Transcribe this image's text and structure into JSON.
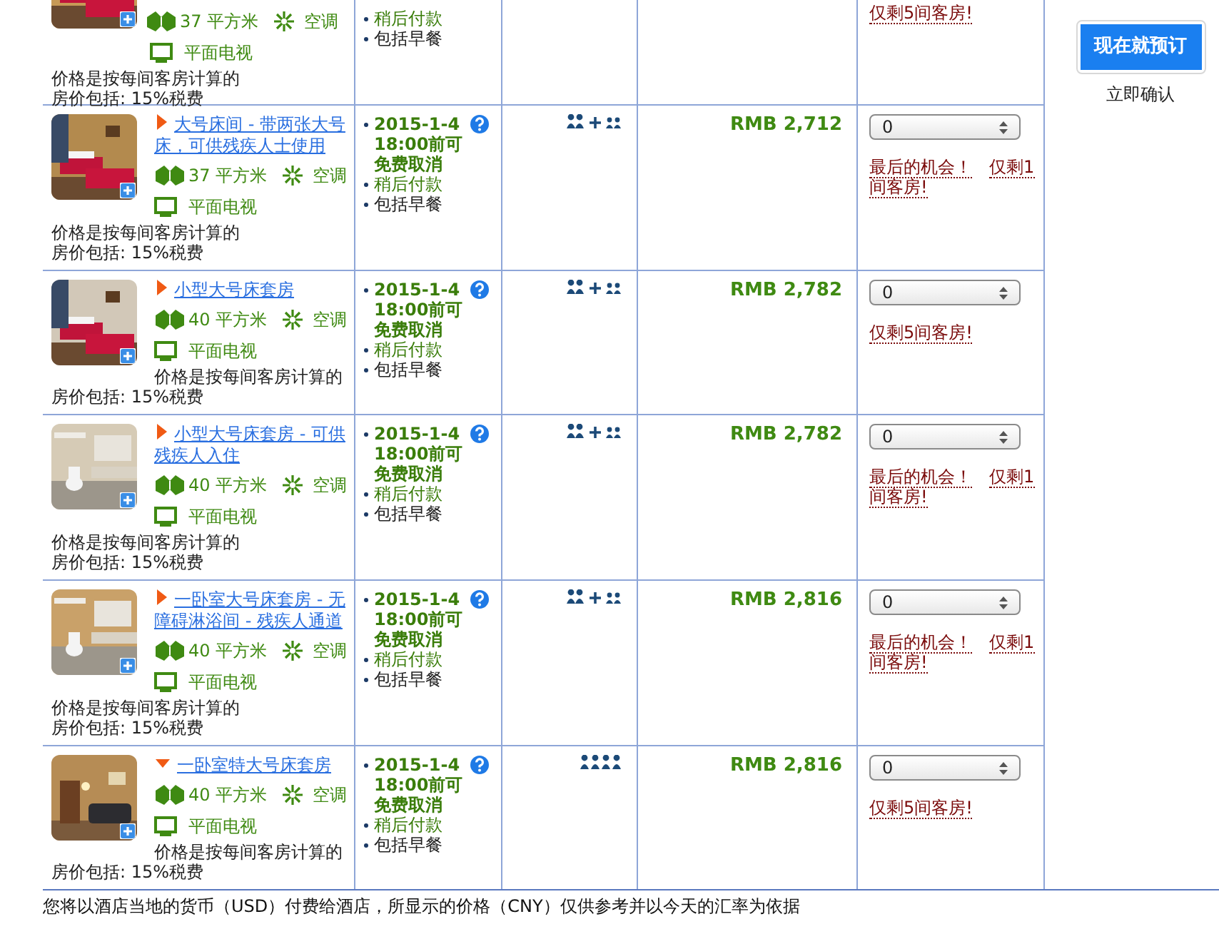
{
  "rooms": [
    {
      "size": "37 平方米",
      "aircon": "空调",
      "tv": "平面电视",
      "price_note": "价格是按每间客房计算的",
      "tax_note": "房价包括: 15%税费",
      "policies": [
        {
          "kind": "payment",
          "text": "稍后付款"
        },
        {
          "kind": "breakfast",
          "text": "包括早餐"
        }
      ],
      "availability": [
        "仅剩5间客房!"
      ]
    },
    {
      "title": "大号床间 - 带两张大号床，可供残疾人士使用",
      "expanded": false,
      "size": "37 平方米",
      "aircon": "空调",
      "tv": "平面电视",
      "price_note": "价格是按每间客房计算的",
      "tax_note": "房价包括: 15%税费",
      "policies": [
        {
          "kind": "cancel",
          "text": "2015-1-4 18:00前可免费取消"
        },
        {
          "kind": "payment",
          "text": "稍后付款"
        },
        {
          "kind": "breakfast",
          "text": "包括早餐"
        }
      ],
      "occupancy": {
        "kind": "adults_plus_children"
      },
      "price": "RMB 2,712",
      "quantity": "0",
      "availability": [
        "最后的机会！",
        "仅剩1间客房!"
      ]
    },
    {
      "title": "小型大号床套房",
      "expanded": false,
      "size": "40 平方米",
      "aircon": "空调",
      "tv": "平面电视",
      "price_note": "价格是按每间客房计算的",
      "tax_note": "房价包括: 15%税费",
      "policies": [
        {
          "kind": "cancel",
          "text": "2015-1-4 18:00前可免费取消"
        },
        {
          "kind": "payment",
          "text": "稍后付款"
        },
        {
          "kind": "breakfast",
          "text": "包括早餐"
        }
      ],
      "occupancy": {
        "kind": "adults_plus_children"
      },
      "price": "RMB 2,782",
      "quantity": "0",
      "availability": [
        "仅剩5间客房!"
      ]
    },
    {
      "title": "小型大号床套房 - 可供残疾人入住",
      "expanded": false,
      "size": "40 平方米",
      "aircon": "空调",
      "tv": "平面电视",
      "price_note": "价格是按每间客房计算的",
      "tax_note": "房价包括: 15%税费",
      "policies": [
        {
          "kind": "cancel",
          "text": "2015-1-4 18:00前可免费取消"
        },
        {
          "kind": "payment",
          "text": "稍后付款"
        },
        {
          "kind": "breakfast",
          "text": "包括早餐"
        }
      ],
      "occupancy": {
        "kind": "adults_plus_children"
      },
      "price": "RMB 2,782",
      "quantity": "0",
      "availability": [
        "最后的机会！",
        "仅剩1间客房!"
      ]
    },
    {
      "title": "一卧室大号床套房 - 无障碍淋浴间 - 残疾人通道",
      "expanded": false,
      "size": "40 平方米",
      "aircon": "空调",
      "tv": "平面电视",
      "price_note": "价格是按每间客房计算的",
      "tax_note": "房价包括: 15%税费",
      "policies": [
        {
          "kind": "cancel",
          "text": "2015-1-4 18:00前可免费取消"
        },
        {
          "kind": "payment",
          "text": "稍后付款"
        },
        {
          "kind": "breakfast",
          "text": "包括早餐"
        }
      ],
      "occupancy": {
        "kind": "adults_plus_children"
      },
      "price": "RMB 2,816",
      "quantity": "0",
      "availability": [
        "最后的机会！",
        "仅剩1间客房!"
      ]
    },
    {
      "title": "一卧室特大号床套房",
      "expanded": true,
      "size": "40 平方米",
      "aircon": "空调",
      "tv": "平面电视",
      "price_note": "价格是按每间客房计算的",
      "tax_note": "房价包括: 15%税费",
      "policies": [
        {
          "kind": "cancel",
          "text": "2015-1-4 18:00前可免费取消"
        },
        {
          "kind": "payment",
          "text": "稍后付款"
        },
        {
          "kind": "breakfast",
          "text": "包括早餐"
        }
      ],
      "occupancy": {
        "kind": "group_of_four"
      },
      "price": "RMB 2,816",
      "quantity": "0",
      "availability": [
        "仅剩5间客房!"
      ]
    }
  ],
  "book_button": "现在就预订",
  "book_note": "立即确认",
  "footer_note": "您将以酒店当地的货币（USD）付费给酒店，所显示的价格（CNY）仅供参考并以今天的汇率为依据"
}
